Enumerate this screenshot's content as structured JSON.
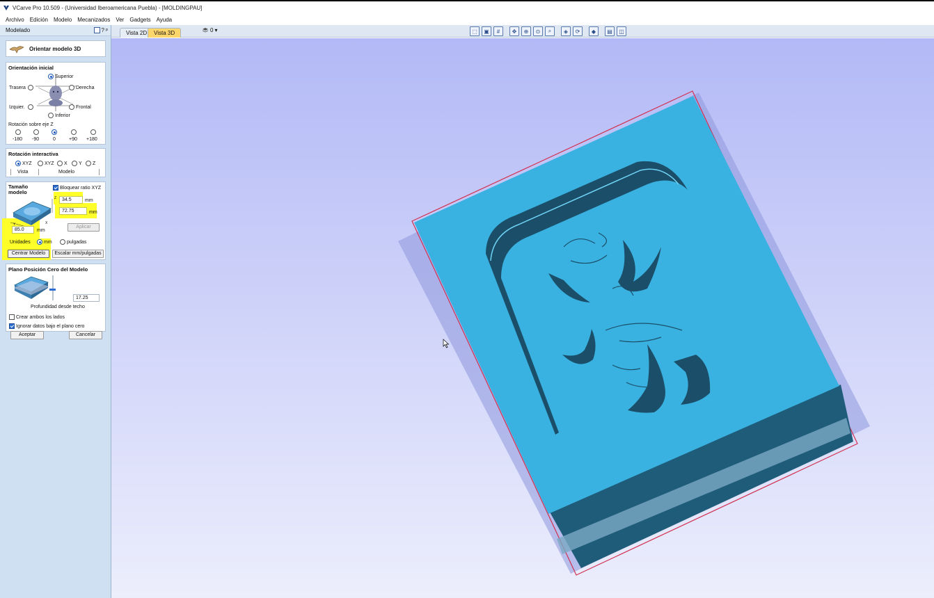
{
  "window": {
    "title": "VCarve Pro 10.509 - (Universidad Iberoamericana Puebla) - [MOLDINGPAU]"
  },
  "menu": [
    "Archivo",
    "Edición",
    "Modelo",
    "Mecanizados",
    "Ver",
    "Gadgets",
    "Ayuda"
  ],
  "panel": {
    "title": "Modelado",
    "help_glyph": "?",
    "pin_glyph": "ᵖ",
    "tool_title": "Orientar modelo 3D",
    "orientation": {
      "title": "Orientación inicial",
      "superior": "Superior",
      "trasera": "Trasera",
      "derecha": "Derecha",
      "izquier": "Izquier.",
      "frontal": "Frontal",
      "inferior": "Inferior",
      "selected": "Superior",
      "z_rotation_label": "Rotación sobre eje Z",
      "z_options": [
        "-180",
        "-90",
        "0",
        "+90",
        "+180"
      ],
      "z_selected": "0"
    },
    "interactive_rotation": {
      "title": "Rotación interactiva",
      "options": [
        "XYZ",
        "XYZ",
        "X",
        "Y",
        "Z"
      ],
      "selected": 0,
      "vista_label": "Vista",
      "modelo_label": "Modelo"
    },
    "model_size": {
      "title_line1": "Tamaño",
      "title_line2": "modelo",
      "lock_ratio_label": "Bloquear ratio XYZ",
      "lock_ratio_checked": true,
      "z_value": "34.5",
      "y_value": "72.75",
      "x_value": "85.0",
      "unit_mm": "mm",
      "axis_x": "X",
      "axis_y": "Y",
      "axis_z": "Z",
      "apply_label": "Aplicar",
      "units_label": "Unidades",
      "unit_mm_option": "mm",
      "unit_in_option": "pulgadas",
      "unit_selected": "mm",
      "center_label": "Centrar Modelo",
      "scale_label": "Escalar mm/pulgadas"
    },
    "zero_plane": {
      "title": "Plano Posición Cero del Modelo",
      "depth_value": "17.25",
      "depth_label": "Profundidad desde techo",
      "both_sides_label": "Crear ambos los lados",
      "both_sides_checked": false,
      "ignore_below_label": "Ignorar datos bajo el plano cero",
      "ignore_below_checked": true
    },
    "accept_label": "Aceptar",
    "cancel_label": "Cancelar"
  },
  "view_tabs": {
    "tab_2d": "Vista 2D",
    "tab_3d": "Vista 3D",
    "active": "Vista 3D",
    "layer_label": "0"
  },
  "colors": {
    "panel_bg": "#cfe0f2",
    "model_blue": "#3ab2e1",
    "model_dark": "#20607e",
    "highlight": "#ffff2a",
    "tab_active": "#ffd66b",
    "boundary_red": "#d23050"
  }
}
